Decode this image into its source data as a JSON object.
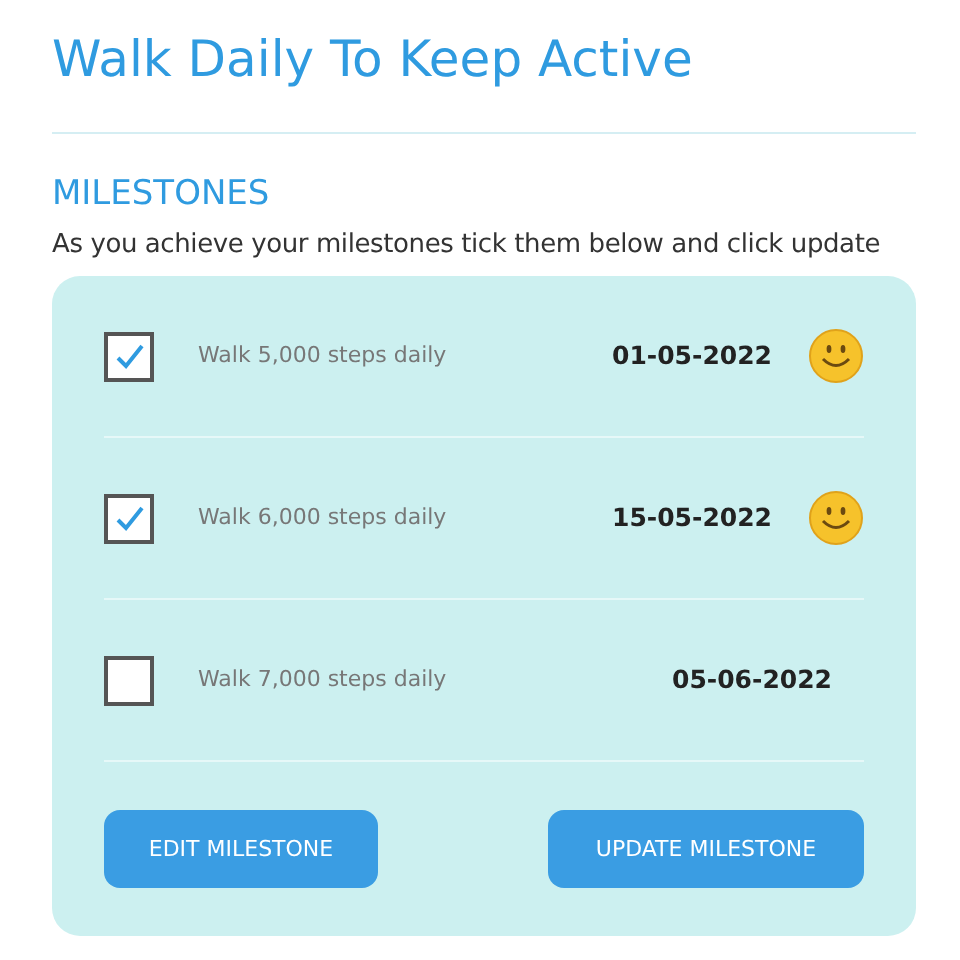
{
  "title": "Walk Daily To Keep Active",
  "section": {
    "heading": "MILESTONES",
    "instructions": "As you achieve your milestones tick them below and click update"
  },
  "milestones": [
    {
      "label": "Walk 5,000 steps daily",
      "date": "01-05-2022",
      "checked": true
    },
    {
      "label": "Walk 6,000 steps daily",
      "date": "15-05-2022",
      "checked": true
    },
    {
      "label": "Walk 7,000 steps daily",
      "date": "05-06-2022",
      "checked": false
    }
  ],
  "buttons": [
    {
      "label": "EDIT MILESTONE"
    },
    {
      "label": "UPDATE MILESTONE"
    }
  ]
}
